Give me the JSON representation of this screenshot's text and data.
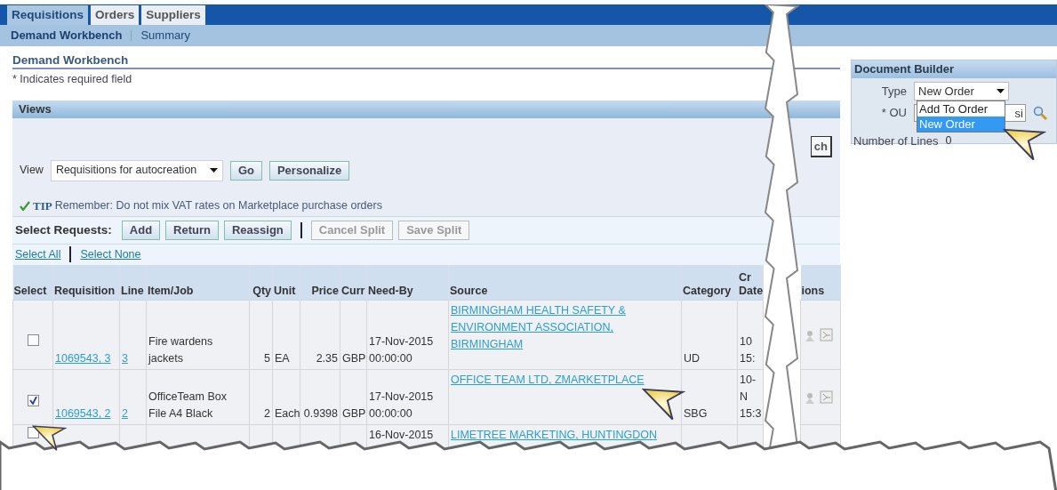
{
  "tabs": [
    {
      "label": "Requisitions",
      "selected": true
    },
    {
      "label": "Orders",
      "selected": false
    },
    {
      "label": "Suppliers",
      "selected": false
    }
  ],
  "subtabs": [
    {
      "label": "Demand Workbench",
      "selected": true
    },
    {
      "label": "Summary",
      "selected": false
    }
  ],
  "page": {
    "title": "Demand Workbench",
    "required_note": "* Indicates required field"
  },
  "views": {
    "title": "Views",
    "search_button": "ch",
    "view_label": "View",
    "view_value": "Requisitions for autocreation",
    "buttons": [
      "Go",
      "Personalize"
    ],
    "tip_label": "TIP",
    "tip_text": "Remember: Do not mix VAT rates on Marketplace purchase orders"
  },
  "select_requests": {
    "label": "Select Requests:",
    "buttons": [
      {
        "label": "Add",
        "disabled": false
      },
      {
        "label": "Return",
        "disabled": false
      },
      {
        "label": "Reassign",
        "disabled": false
      },
      {
        "label": "Cancel Split",
        "disabled": true
      },
      {
        "label": "Save Split",
        "disabled": true
      }
    ]
  },
  "selection_links": [
    "Select All",
    "Select None"
  ],
  "table": {
    "columns": [
      "Select",
      "Requisition",
      "Line",
      "Item/Job",
      "Qty",
      "Unit",
      "Price",
      "Curr",
      "Need-By",
      "Source",
      "Category",
      "Cr Date",
      "ions"
    ],
    "rows": [
      {
        "checked": false,
        "requisition": "1069543, 3",
        "line": "3",
        "item": "Fire wardens jackets",
        "qty": "5",
        "unit": "EA",
        "price": "2.35",
        "curr": "GBP",
        "need_by": "17-Nov-2015 00:00:00",
        "source": "BIRMINGHAM HEALTH SAFETY & ENVIRONMENT ASSOCIATION, BIRMINGHAM",
        "category": "UD",
        "created": "10 15:"
      },
      {
        "checked": true,
        "requisition": "1069543, 2",
        "line": "2",
        "item": "OfficeTeam Box File A4 Black",
        "qty": "2",
        "unit": "Each",
        "price": "0.9398",
        "curr": "GBP",
        "need_by": "17-Nov-2015 00:00:00",
        "source": "OFFICE TEAM LTD, ZMARKETPLACE",
        "category": "SBG",
        "created": "10-N 15:3"
      },
      {
        "checked": false,
        "need_by": "16-Nov-2015",
        "source": "LIMETREE MARKETING, HUNTINGDON"
      }
    ]
  },
  "document_builder": {
    "title": "Document Builder",
    "type_label": "Type",
    "type_value": "New Order",
    "type_options": [
      {
        "label": "Add To Order",
        "selected": false
      },
      {
        "label": "New Order",
        "selected": true
      }
    ],
    "ou_label": "* OU",
    "ou_value": "si",
    "lines_label": "Number of Lines",
    "lines_value": "0"
  }
}
